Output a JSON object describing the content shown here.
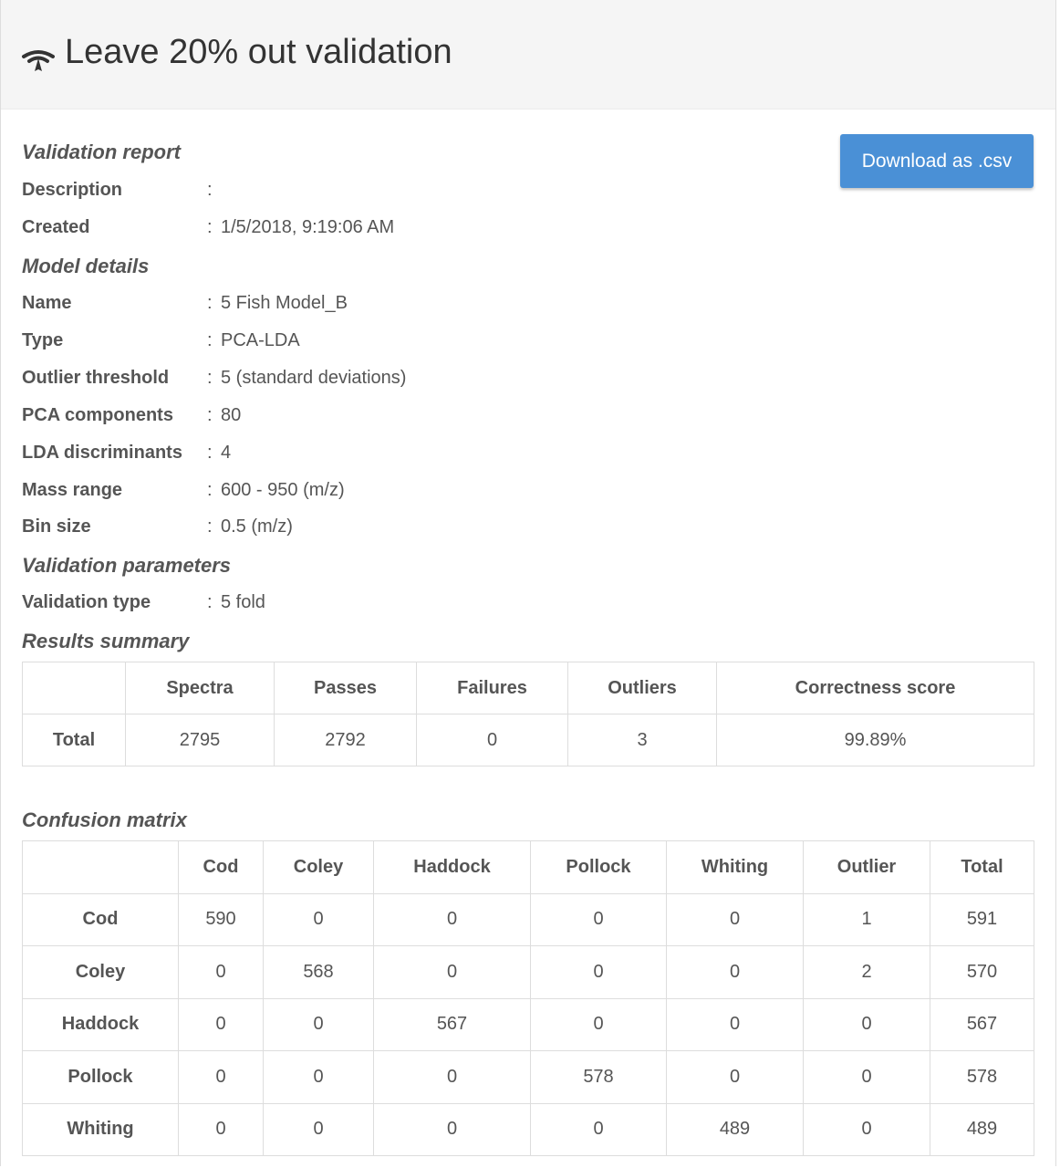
{
  "header": {
    "title": "Leave 20% out validation",
    "icon": "wifi-fan-icon"
  },
  "download_button": {
    "label": "Download as .csv",
    "color": "#4a90d6"
  },
  "report": {
    "title": "Validation report",
    "sections": [
      {
        "heading": null,
        "rows": [
          {
            "label": "Description",
            "value": ""
          },
          {
            "label": "Created",
            "value": "1/5/2018, 9:19:06 AM"
          }
        ]
      }
    ]
  },
  "labels": {
    "validation_report": "Validation report",
    "model_details": "Model details",
    "validation_parameters": "Validation parameters",
    "results_summary": "Results summary",
    "confusion_matrix": "Confusion matrix",
    "separator": ":"
  },
  "report_rows": [
    {
      "label": "Description",
      "value": ""
    },
    {
      "label": "Created",
      "value": "1/5/2018, 9:19:06 AM"
    }
  ],
  "model_rows": [
    {
      "label": "Name",
      "value": "5 Fish Model_B"
    },
    {
      "label": "Type",
      "value": "PCA-LDA"
    },
    {
      "label": "Outlier threshold",
      "value": "5 (standard deviations)"
    },
    {
      "label": "PCA components",
      "value": "80"
    },
    {
      "label": "LDA discriminants",
      "value": "4"
    },
    {
      "label": "Mass range",
      "value": "600 - 950 (m/z)"
    },
    {
      "label": "Bin size",
      "value": "0.5 (m/z)"
    }
  ],
  "validation_rows": [
    {
      "label": "Validation type",
      "value": "5 fold"
    }
  ],
  "summary": {
    "headers": [
      "",
      "Spectra",
      "Passes",
      "Failures",
      "Outliers",
      "Correctness score"
    ],
    "rows": [
      [
        "Total",
        "2795",
        "2792",
        "0",
        "3",
        "99.89%"
      ]
    ]
  },
  "confusion": {
    "headers": [
      "",
      "Cod",
      "Coley",
      "Haddock",
      "Pollock",
      "Whiting",
      "Outlier",
      "Total"
    ],
    "rows": [
      [
        "Cod",
        "590",
        "0",
        "0",
        "0",
        "0",
        "1",
        "591"
      ],
      [
        "Coley",
        "0",
        "568",
        "0",
        "0",
        "0",
        "2",
        "570"
      ],
      [
        "Haddock",
        "0",
        "0",
        "567",
        "0",
        "0",
        "0",
        "567"
      ],
      [
        "Pollock",
        "0",
        "0",
        "0",
        "578",
        "0",
        "0",
        "578"
      ],
      [
        "Whiting",
        "0",
        "0",
        "0",
        "0",
        "489",
        "0",
        "489"
      ]
    ]
  }
}
